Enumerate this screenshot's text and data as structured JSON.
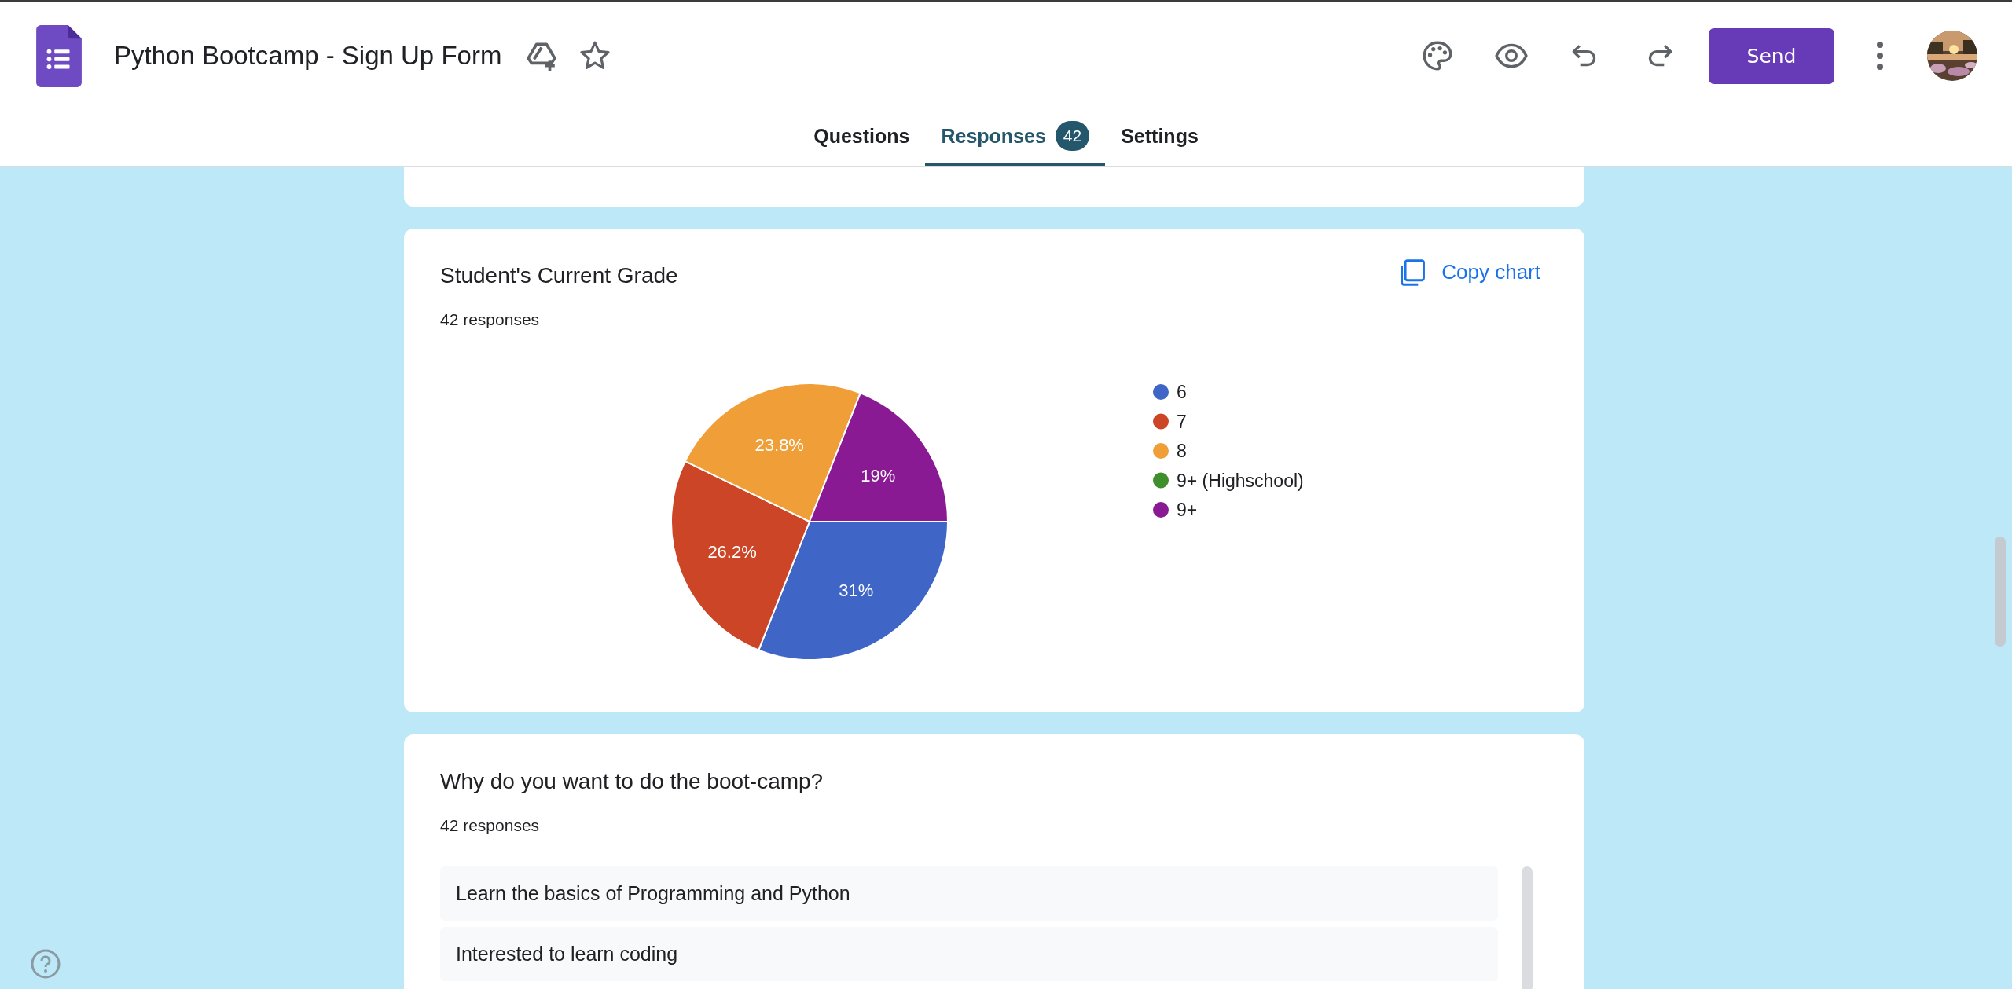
{
  "header": {
    "title": "Python Bootcamp - Sign Up Form",
    "starred": false,
    "send_button": "Send"
  },
  "tabs": [
    {
      "label": "Questions",
      "selected": false
    },
    {
      "label": "Responses",
      "selected": true,
      "badge": "42"
    },
    {
      "label": "Settings",
      "selected": false
    }
  ],
  "cards": [
    {
      "kind": "chart",
      "title": "Student's Current Grade",
      "count": "42 responses",
      "action": "Copy chart",
      "chart_data": {
        "type": "pie",
        "categories": [
          "6",
          "7",
          "8",
          "9+ (Highschool)",
          "9+"
        ],
        "series": [
          {
            "values": [
              31,
              26.2,
              23.8,
              0,
              19
            ]
          }
        ],
        "legend": "right",
        "colors": [
          "#3f66c7",
          "#cc4526",
          "#f09e37",
          "#3f8f2c",
          "#8a1a94"
        ],
        "value_labels": [
          "31%",
          "26.2%",
          "23.8%",
          null,
          "19%"
        ]
      }
    },
    {
      "kind": "list",
      "title": "Why do you want to do the boot-camp?",
      "count": "42 responses",
      "answers": [
        "Learn the basics of Programming and Python",
        "Interested to learn coding"
      ]
    }
  ]
}
